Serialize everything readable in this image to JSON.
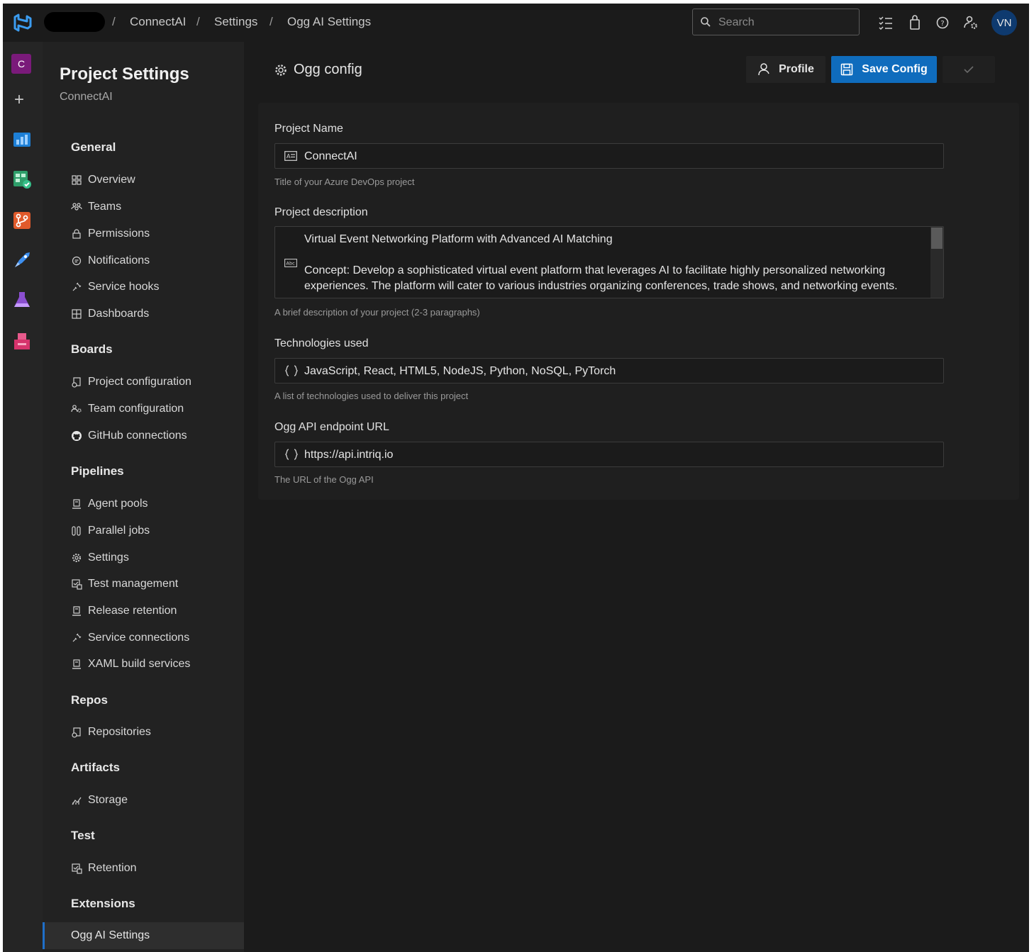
{
  "topbar": {
    "breadcrumbs": [
      "ConnectAI",
      "Settings",
      "Ogg AI Settings"
    ],
    "search_placeholder": "Search",
    "avatar_initials": "VN"
  },
  "rail": {
    "project_initial": "C",
    "add_label": "+"
  },
  "sidebar": {
    "title": "Project Settings",
    "subtitle": "ConnectAI",
    "sections": {
      "general": {
        "label": "General",
        "items": [
          "Overview",
          "Teams",
          "Permissions",
          "Notifications",
          "Service hooks",
          "Dashboards"
        ]
      },
      "boards": {
        "label": "Boards",
        "items": [
          "Project configuration",
          "Team configuration",
          "GitHub connections"
        ]
      },
      "pipelines": {
        "label": "Pipelines",
        "items": [
          "Agent pools",
          "Parallel jobs",
          "Settings",
          "Test management",
          "Release retention",
          "Service connections",
          "XAML build services"
        ]
      },
      "repos": {
        "label": "Repos",
        "items": [
          "Repositories"
        ]
      },
      "artifacts": {
        "label": "Artifacts",
        "items": [
          "Storage"
        ]
      },
      "test": {
        "label": "Test",
        "items": [
          "Retention"
        ]
      },
      "extensions": {
        "label": "Extensions",
        "items": [
          "Ogg AI Settings"
        ]
      }
    }
  },
  "main": {
    "title": "Ogg config",
    "profile_label": "Profile",
    "save_label": "Save Config",
    "fields": {
      "project_name": {
        "label": "Project Name",
        "value": "ConnectAI",
        "help": "Title of your Azure DevOps project"
      },
      "description": {
        "label": "Project description",
        "lines": [
          "Virtual Event Networking Platform with Advanced AI Matching",
          "Concept: Develop a sophisticated virtual event platform that leverages AI to facilitate highly personalized networking",
          "experiences. The platform will cater to various industries organizing conferences, trade shows, and networking events."
        ],
        "help": "A brief description of your project (2-3 paragraphs)"
      },
      "technologies": {
        "label": "Technologies used",
        "value": "JavaScript, React, HTML5, NodeJS, Python, NoSQL, PyTorch",
        "help": "A list of technologies used to deliver this project"
      },
      "endpoint": {
        "label": "Ogg API endpoint URL",
        "value": "https://api.intriq.io",
        "help": "The URL of the Ogg API"
      }
    }
  },
  "colors": {
    "accent": "#0f6cbd",
    "background": "#1b1b1b",
    "sidebar": "#222222"
  }
}
